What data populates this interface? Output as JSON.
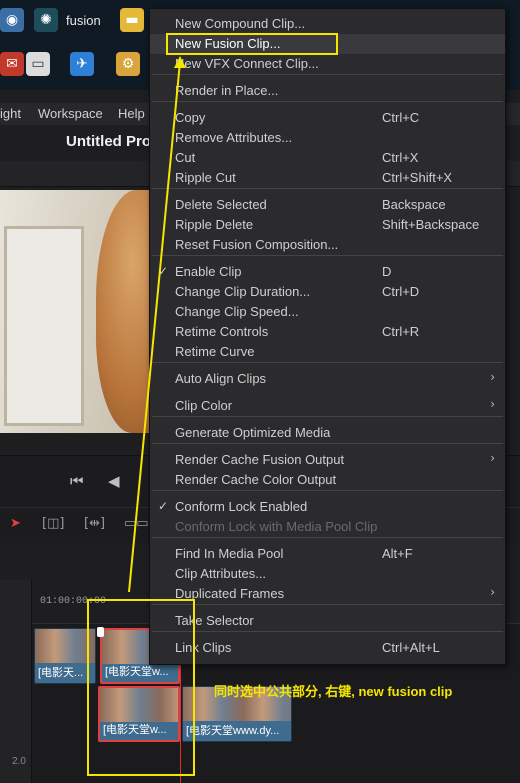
{
  "taskbar": {
    "app_fusion": "fusion",
    "icons": [
      "globe-icon",
      "fusion-icon",
      "folder-icon",
      "mail-icon",
      "monitor-icon",
      "bird-icon",
      "app-icon"
    ]
  },
  "app_menu": {
    "items": [
      "ight",
      "Workspace",
      "Help"
    ],
    "project_title": "Untitled Pro"
  },
  "timeline": {
    "timecode": "01:00:00:00",
    "track2_label": "2.0",
    "clips": [
      {
        "label": "[电影天..."
      },
      {
        "label": "[电影天堂w..."
      },
      {
        "label": "[电影天堂w..."
      },
      {
        "label": "[电影天堂www.dy..."
      }
    ]
  },
  "context_menu": {
    "items": [
      {
        "label": "New Compound Clip...",
        "shortcut": "",
        "disabled": false
      },
      {
        "label": "New Fusion Clip...",
        "shortcut": "",
        "disabled": false,
        "highlight": true
      },
      {
        "label": "New VFX Connect Clip...",
        "shortcut": "",
        "disabled": false
      },
      {
        "label": "Render in Place...",
        "shortcut": "",
        "disabled": false
      },
      {
        "label": "Copy",
        "shortcut": "Ctrl+C",
        "disabled": false
      },
      {
        "label": "Remove Attributes...",
        "shortcut": "",
        "disabled": false
      },
      {
        "label": "Cut",
        "shortcut": "Ctrl+X",
        "disabled": false
      },
      {
        "label": "Ripple Cut",
        "shortcut": "Ctrl+Shift+X",
        "disabled": false
      },
      {
        "label": "Delete Selected",
        "shortcut": "Backspace",
        "disabled": false
      },
      {
        "label": "Ripple Delete",
        "shortcut": "Shift+Backspace",
        "disabled": false
      },
      {
        "label": "Reset Fusion Composition...",
        "shortcut": "",
        "disabled": false
      },
      {
        "label": "Enable Clip",
        "shortcut": "D",
        "disabled": false,
        "checked": true
      },
      {
        "label": "Change Clip Duration...",
        "shortcut": "Ctrl+D",
        "disabled": false
      },
      {
        "label": "Change Clip Speed...",
        "shortcut": "",
        "disabled": false
      },
      {
        "label": "Retime Controls",
        "shortcut": "Ctrl+R",
        "disabled": false
      },
      {
        "label": "Retime Curve",
        "shortcut": "",
        "disabled": false
      },
      {
        "label": "Auto Align Clips",
        "shortcut": "",
        "disabled": false,
        "submenu": true
      },
      {
        "label": "Clip Color",
        "shortcut": "",
        "disabled": false,
        "submenu": true
      },
      {
        "label": "Generate Optimized Media",
        "shortcut": "",
        "disabled": false
      },
      {
        "label": "Render Cache Fusion Output",
        "shortcut": "",
        "disabled": false,
        "submenu": true
      },
      {
        "label": "Render Cache Color Output",
        "shortcut": "",
        "disabled": false
      },
      {
        "label": "Conform Lock Enabled",
        "shortcut": "",
        "disabled": false,
        "checked": true
      },
      {
        "label": "Conform Lock with Media Pool Clip",
        "shortcut": "",
        "disabled": true
      },
      {
        "label": "Find In Media Pool",
        "shortcut": "Alt+F",
        "disabled": false
      },
      {
        "label": "Clip Attributes...",
        "shortcut": "",
        "disabled": false
      },
      {
        "label": "Duplicated Frames",
        "shortcut": "",
        "disabled": false,
        "submenu": true
      },
      {
        "label": "Take Selector",
        "shortcut": "",
        "disabled": false
      },
      {
        "label": "Link Clips",
        "shortcut": "Ctrl+Alt+L",
        "disabled": false
      }
    ]
  },
  "annotation": {
    "text": "同时选中公共部分, 右键, new fusion clip",
    "color": "#f5e600"
  },
  "colors": {
    "menu_bg": "#2b2b2e",
    "clip_blue": "#3e6b8e",
    "selection_red": "#e04040",
    "playhead_red": "#e03030"
  }
}
